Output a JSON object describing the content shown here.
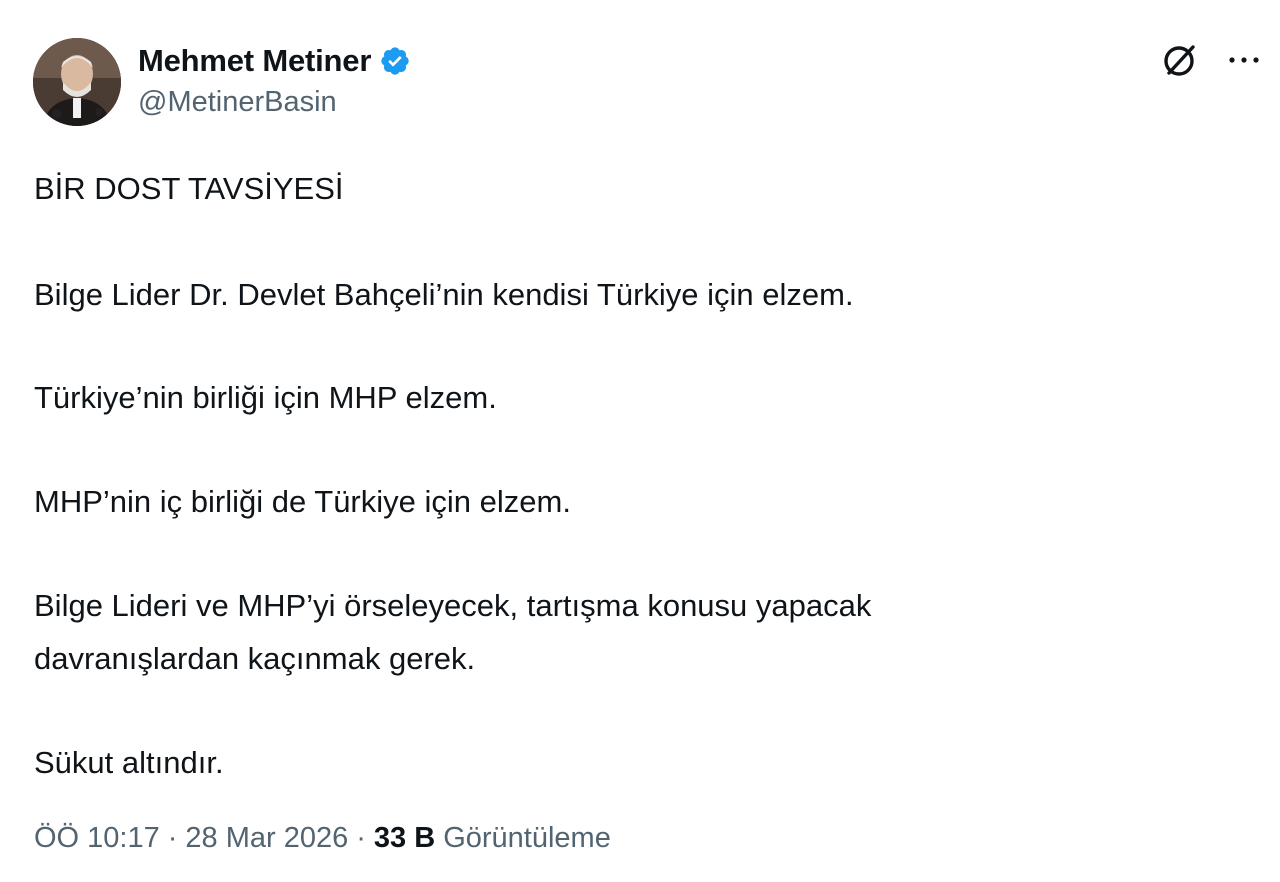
{
  "author": {
    "display_name": "Mehmet Metiner",
    "handle": "@MetinerBasin",
    "verified": true
  },
  "actions": {
    "grok_icon": "grok-icon",
    "more_icon": "more-dots-icon"
  },
  "tweet": {
    "paragraphs": [
      "BİR DOST TAVSİYESİ",
      "Bilge Lider Dr. Devlet Bahçeli’nin kendisi Türkiye için elzem.",
      "Türkiye’nin birliği için MHP elzem.",
      "MHP’nin iç birliği de Türkiye için elzem.",
      "Bilge Lideri ve MHP’yi örseleyecek, tartışma konusu yapacak",
      "davranışlardan kaçınmak gerek.",
      "Sükut altındır."
    ]
  },
  "meta": {
    "time": "ÖÖ 10:17",
    "separator": "·",
    "date": "28 Mar 2026",
    "views_count": "33 B",
    "views_label": "Görüntüleme"
  },
  "colors": {
    "text": "#0f1419",
    "secondary": "#536471",
    "verified": "#1d9bf0"
  }
}
